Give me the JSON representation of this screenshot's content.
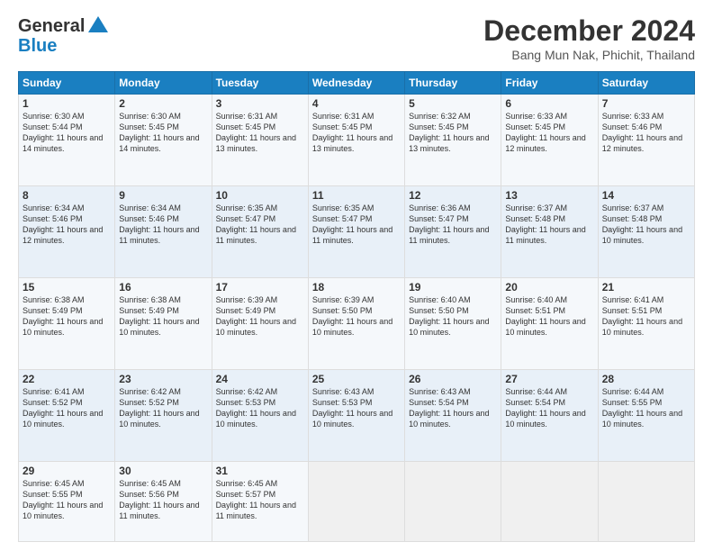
{
  "header": {
    "logo_line1": "General",
    "logo_line2": "Blue",
    "title": "December 2024",
    "location": "Bang Mun Nak, Phichit, Thailand"
  },
  "days_of_week": [
    "Sunday",
    "Monday",
    "Tuesday",
    "Wednesday",
    "Thursday",
    "Friday",
    "Saturday"
  ],
  "weeks": [
    [
      {
        "day": 1,
        "sunrise": "6:30 AM",
        "sunset": "5:44 PM",
        "daylight": "11 hours and 14 minutes."
      },
      {
        "day": 2,
        "sunrise": "6:30 AM",
        "sunset": "5:45 PM",
        "daylight": "11 hours and 14 minutes."
      },
      {
        "day": 3,
        "sunrise": "6:31 AM",
        "sunset": "5:45 PM",
        "daylight": "11 hours and 13 minutes."
      },
      {
        "day": 4,
        "sunrise": "6:31 AM",
        "sunset": "5:45 PM",
        "daylight": "11 hours and 13 minutes."
      },
      {
        "day": 5,
        "sunrise": "6:32 AM",
        "sunset": "5:45 PM",
        "daylight": "11 hours and 13 minutes."
      },
      {
        "day": 6,
        "sunrise": "6:33 AM",
        "sunset": "5:45 PM",
        "daylight": "11 hours and 12 minutes."
      },
      {
        "day": 7,
        "sunrise": "6:33 AM",
        "sunset": "5:46 PM",
        "daylight": "11 hours and 12 minutes."
      }
    ],
    [
      {
        "day": 8,
        "sunrise": "6:34 AM",
        "sunset": "5:46 PM",
        "daylight": "11 hours and 12 minutes."
      },
      {
        "day": 9,
        "sunrise": "6:34 AM",
        "sunset": "5:46 PM",
        "daylight": "11 hours and 11 minutes."
      },
      {
        "day": 10,
        "sunrise": "6:35 AM",
        "sunset": "5:47 PM",
        "daylight": "11 hours and 11 minutes."
      },
      {
        "day": 11,
        "sunrise": "6:35 AM",
        "sunset": "5:47 PM",
        "daylight": "11 hours and 11 minutes."
      },
      {
        "day": 12,
        "sunrise": "6:36 AM",
        "sunset": "5:47 PM",
        "daylight": "11 hours and 11 minutes."
      },
      {
        "day": 13,
        "sunrise": "6:37 AM",
        "sunset": "5:48 PM",
        "daylight": "11 hours and 11 minutes."
      },
      {
        "day": 14,
        "sunrise": "6:37 AM",
        "sunset": "5:48 PM",
        "daylight": "11 hours and 10 minutes."
      }
    ],
    [
      {
        "day": 15,
        "sunrise": "6:38 AM",
        "sunset": "5:49 PM",
        "daylight": "11 hours and 10 minutes."
      },
      {
        "day": 16,
        "sunrise": "6:38 AM",
        "sunset": "5:49 PM",
        "daylight": "11 hours and 10 minutes."
      },
      {
        "day": 17,
        "sunrise": "6:39 AM",
        "sunset": "5:49 PM",
        "daylight": "11 hours and 10 minutes."
      },
      {
        "day": 18,
        "sunrise": "6:39 AM",
        "sunset": "5:50 PM",
        "daylight": "11 hours and 10 minutes."
      },
      {
        "day": 19,
        "sunrise": "6:40 AM",
        "sunset": "5:50 PM",
        "daylight": "11 hours and 10 minutes."
      },
      {
        "day": 20,
        "sunrise": "6:40 AM",
        "sunset": "5:51 PM",
        "daylight": "11 hours and 10 minutes."
      },
      {
        "day": 21,
        "sunrise": "6:41 AM",
        "sunset": "5:51 PM",
        "daylight": "11 hours and 10 minutes."
      }
    ],
    [
      {
        "day": 22,
        "sunrise": "6:41 AM",
        "sunset": "5:52 PM",
        "daylight": "11 hours and 10 minutes."
      },
      {
        "day": 23,
        "sunrise": "6:42 AM",
        "sunset": "5:52 PM",
        "daylight": "11 hours and 10 minutes."
      },
      {
        "day": 24,
        "sunrise": "6:42 AM",
        "sunset": "5:53 PM",
        "daylight": "11 hours and 10 minutes."
      },
      {
        "day": 25,
        "sunrise": "6:43 AM",
        "sunset": "5:53 PM",
        "daylight": "11 hours and 10 minutes."
      },
      {
        "day": 26,
        "sunrise": "6:43 AM",
        "sunset": "5:54 PM",
        "daylight": "11 hours and 10 minutes."
      },
      {
        "day": 27,
        "sunrise": "6:44 AM",
        "sunset": "5:54 PM",
        "daylight": "11 hours and 10 minutes."
      },
      {
        "day": 28,
        "sunrise": "6:44 AM",
        "sunset": "5:55 PM",
        "daylight": "11 hours and 10 minutes."
      }
    ],
    [
      {
        "day": 29,
        "sunrise": "6:45 AM",
        "sunset": "5:55 PM",
        "daylight": "11 hours and 10 minutes."
      },
      {
        "day": 30,
        "sunrise": "6:45 AM",
        "sunset": "5:56 PM",
        "daylight": "11 hours and 11 minutes."
      },
      {
        "day": 31,
        "sunrise": "6:45 AM",
        "sunset": "5:57 PM",
        "daylight": "11 hours and 11 minutes."
      },
      null,
      null,
      null,
      null
    ]
  ]
}
